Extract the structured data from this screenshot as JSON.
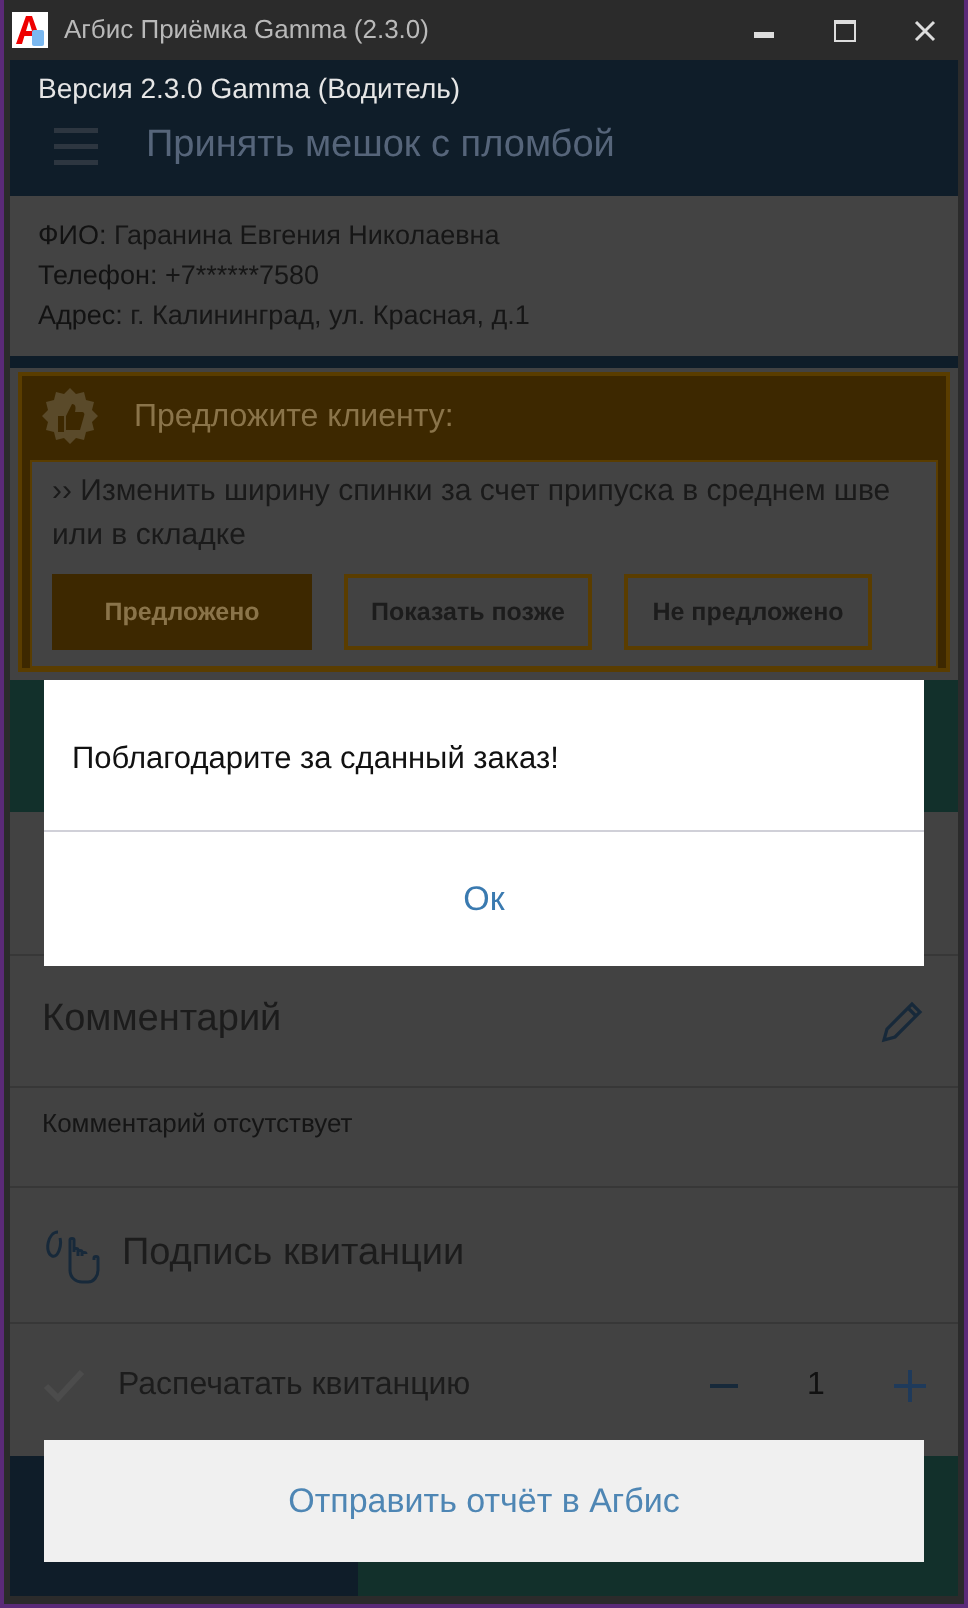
{
  "window": {
    "title": "Агбис Приёмка Gamma (2.3.0)"
  },
  "app": {
    "version": "Версия 2.3.0 Gamma (Водитель)",
    "header_title": "Принять мешок с пломбой"
  },
  "customer": [
    {
      "label": "ФИО:",
      "value": "Гаранина Евгения Николаевна"
    },
    {
      "label": "Телефон:",
      "value": "+7******7580"
    },
    {
      "label": "Адрес:",
      "value": "г. Калининград, ул. Красная, д.1"
    }
  ],
  "suggestion": {
    "title": "Предложите клиенту:",
    "text": "›› Изменить ширину спинки за счет припуска в среднем шве или в складке",
    "buttons": [
      {
        "label": "Предложено",
        "selected": true
      },
      {
        "label": "Показать позже",
        "selected": false
      },
      {
        "label": "Не предложено",
        "selected": false
      }
    ]
  },
  "dialog": {
    "message": "Поблагодарите за сданный заказ!",
    "button": "Ок"
  },
  "comment": {
    "title": "Комментарий",
    "text": "Комментарий отсутствует"
  },
  "signature": {
    "title": "Подпись квитанции"
  },
  "print": {
    "label": "Распечатать квитанцию",
    "checked": false,
    "count": "1"
  },
  "send_button": "Отправить отчёт в Агбис"
}
